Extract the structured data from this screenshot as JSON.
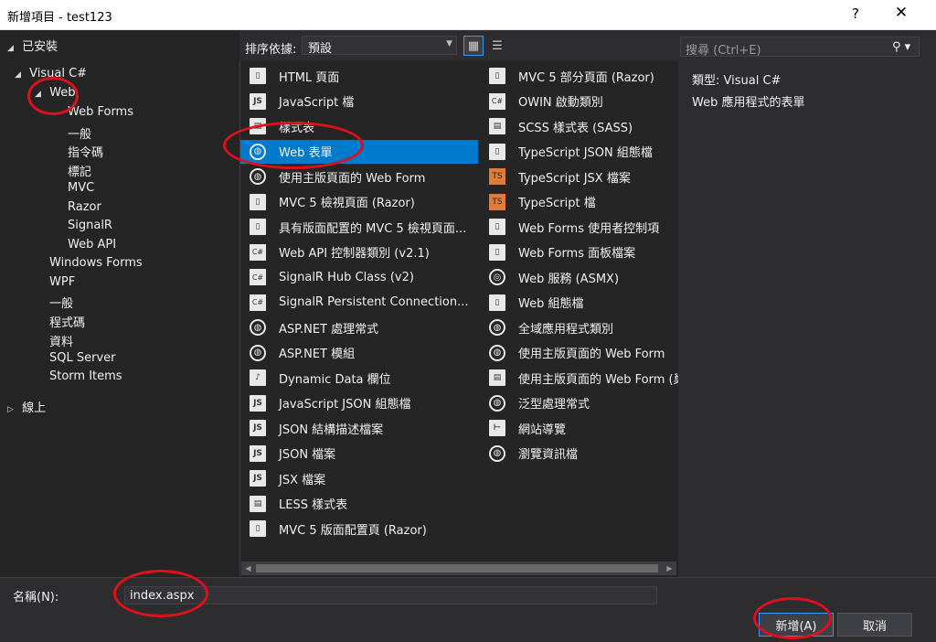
{
  "window": {
    "title": "新增項目 - test123",
    "help": "?",
    "close": "✕"
  },
  "tree": {
    "installed": "已安裝",
    "visual_csharp": "Visual C#",
    "web": "Web",
    "web_children": [
      "Web Forms",
      "一般",
      "指令碼",
      "標記",
      "MVC",
      "Razor",
      "SignalR",
      "Web API"
    ],
    "siblings": [
      "Windows Forms",
      "WPF",
      "一般",
      "程式碼",
      "資料",
      "SQL Server",
      "Storm Items"
    ],
    "online": "線上"
  },
  "toolbar": {
    "sort_label": "排序依據:",
    "sort_value": "預設"
  },
  "items_left": [
    {
      "label": "HTML 頁面",
      "icon": "html-page-icon"
    },
    {
      "label": "JavaScript 檔",
      "icon": "javascript-file-icon"
    },
    {
      "label": "樣式表",
      "icon": "stylesheet-icon"
    },
    {
      "label": "Web 表單",
      "icon": "web-form-icon"
    },
    {
      "label": "使用主版頁面的 Web Form",
      "icon": "web-form-master-icon"
    },
    {
      "label": "MVC 5 檢視頁面 (Razor)",
      "icon": "mvc-view-icon"
    },
    {
      "label": "具有版面配置的 MVC 5 檢視頁面...",
      "icon": "mvc-layout-view-icon"
    },
    {
      "label": "Web API 控制器類別 (v2.1)",
      "icon": "webapi-controller-icon"
    },
    {
      "label": "SignalR Hub Class (v2)",
      "icon": "signalr-hub-icon"
    },
    {
      "label": "SignalR Persistent Connection...",
      "icon": "signalr-connection-icon"
    },
    {
      "label": "ASP.NET 處理常式",
      "icon": "aspnet-handler-icon"
    },
    {
      "label": "ASP.NET 模組",
      "icon": "aspnet-module-icon"
    },
    {
      "label": "Dynamic Data 欄位",
      "icon": "dynamic-data-icon"
    },
    {
      "label": "JavaScript JSON 組態檔",
      "icon": "json-config-icon"
    },
    {
      "label": "JSON 結構描述檔案",
      "icon": "json-schema-icon"
    },
    {
      "label": "JSON 檔案",
      "icon": "json-file-icon"
    },
    {
      "label": "JSX 檔案",
      "icon": "jsx-file-icon"
    },
    {
      "label": "LESS 樣式表",
      "icon": "less-icon"
    },
    {
      "label": "MVC 5 版面配置頁 (Razor)",
      "icon": "mvc-layout-icon"
    }
  ],
  "items_right": [
    {
      "label": "MVC 5 部分頁面 (Razor)",
      "icon": "mvc-partial-icon"
    },
    {
      "label": "OWIN 啟動類別",
      "icon": "owin-icon"
    },
    {
      "label": "SCSS 樣式表 (SASS)",
      "icon": "scss-icon"
    },
    {
      "label": "TypeScript JSON 組態檔",
      "icon": "ts-json-icon"
    },
    {
      "label": "TypeScript JSX 檔案",
      "icon": "tsx-icon"
    },
    {
      "label": "TypeScript 檔",
      "icon": "typescript-icon"
    },
    {
      "label": "Web Forms 使用者控制項",
      "icon": "user-control-icon"
    },
    {
      "label": "Web Forms 面板檔案",
      "icon": "skin-file-icon"
    },
    {
      "label": "Web 服務 (ASMX)",
      "icon": "web-service-icon"
    },
    {
      "label": "Web 組態檔",
      "icon": "web-config-icon"
    },
    {
      "label": "全域應用程式類別",
      "icon": "global-asax-icon"
    },
    {
      "label": "使用主版頁面的 Web Form",
      "icon": "web-form-master-icon"
    },
    {
      "label": "使用主版頁面的 Web Form (巢",
      "icon": "nested-master-icon"
    },
    {
      "label": "泛型處理常式",
      "icon": "generic-handler-icon"
    },
    {
      "label": "網站導覽",
      "icon": "sitemap-icon"
    },
    {
      "label": "瀏覽資訊檔",
      "icon": "browser-file-icon"
    }
  ],
  "selected_item": "Web 表單",
  "search": {
    "placeholder": "搜尋 (Ctrl+E)"
  },
  "description": {
    "type": "類型:  Visual C#",
    "text": "Web 應用程式的表單"
  },
  "bottom": {
    "name_label": "名稱(N):",
    "name_value": "index.aspx",
    "add": "新增(A)",
    "cancel": "取消"
  },
  "colors": {
    "selection": "#007acc",
    "annotation": "#e0101a"
  }
}
